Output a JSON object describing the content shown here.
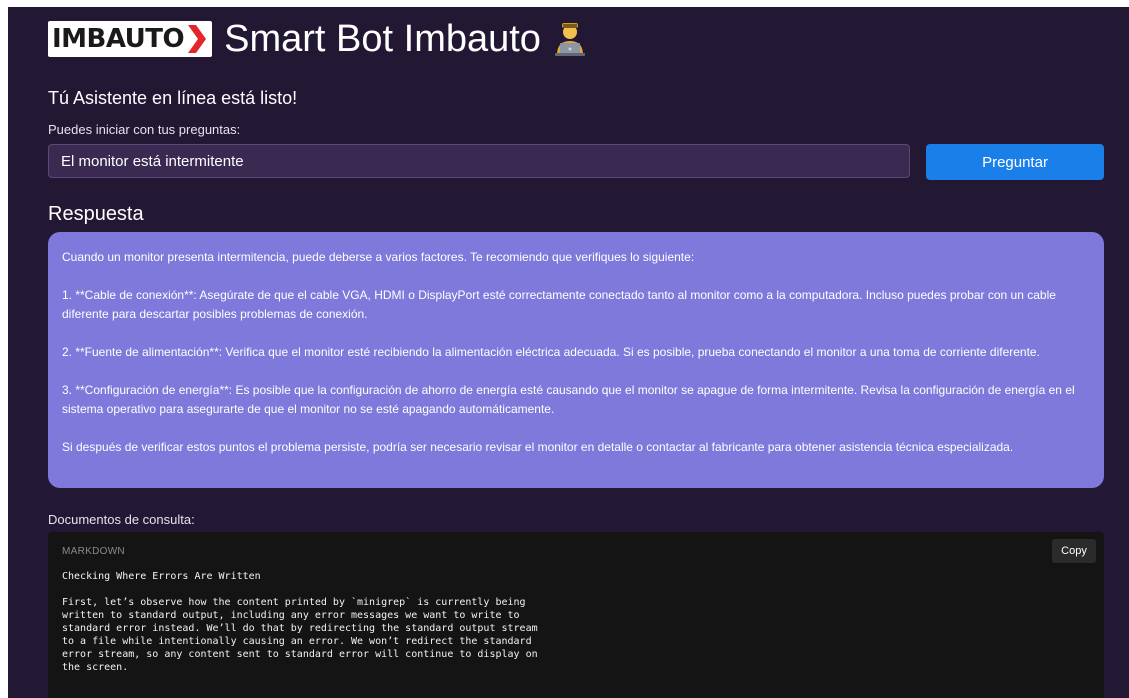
{
  "header": {
    "logo_text": "IMBAUTO",
    "title": "Smart Bot Imbauto"
  },
  "subtitle": "Tú Asistente en línea está listo!",
  "prompt_label": "Puedes iniciar con tus preguntas:",
  "question_input": {
    "value": "El monitor está intermitente"
  },
  "ask_button_label": "Preguntar",
  "answer_heading": "Respuesta",
  "answer_paragraphs": [
    "Cuando un monitor presenta intermitencia, puede deberse a varios factores. Te recomiendo que verifiques lo siguiente:",
    "1. **Cable de conexión**: Asegúrate de que el cable VGA, HDMI o DisplayPort esté correctamente conectado tanto al monitor como a la computadora. Incluso puedes probar con un cable diferente para descartar posibles problemas de conexión.",
    "2. **Fuente de alimentación**: Verifica que el monitor esté recibiendo la alimentación eléctrica adecuada. Si es posible, prueba conectando el monitor a una toma de corriente diferente.",
    "3. **Configuración de energía**: Es posible que la configuración de ahorro de energía esté causando que el monitor se apague de forma intermitente. Revisa la configuración de energía en el sistema operativo para asegurarte de que el monitor no se esté apagando automáticamente.",
    "Si después de verificar estos puntos el problema persiste, podría ser necesario revisar el monitor en detalle o contactar al fabricante para obtener asistencia técnica especializada."
  ],
  "docs_label": "Documentos de consulta:",
  "code_block": {
    "language": "MARKDOWN",
    "copy_label": "Copy",
    "content": "Checking Where Errors Are Written\n\nFirst, let’s observe how the content printed by `minigrep` is currently being\nwritten to standard output, including any error messages we want to write to\nstandard error instead. We’ll do that by redirecting the standard output stream\nto a file while intentionally causing an error. We won’t redirect the standard\nerror stream, so any content sent to standard error will continue to display on\nthe screen."
  },
  "colors": {
    "page_bg": "#231833",
    "answer_bg": "#7f79dc",
    "button_bg": "#1a7fe8",
    "input_bg": "#3a2a52",
    "code_bg": "#141414"
  },
  "icons": {
    "logo_chevron": "red-chevron-icon",
    "title_emoji": "technologist-emoji-icon"
  }
}
